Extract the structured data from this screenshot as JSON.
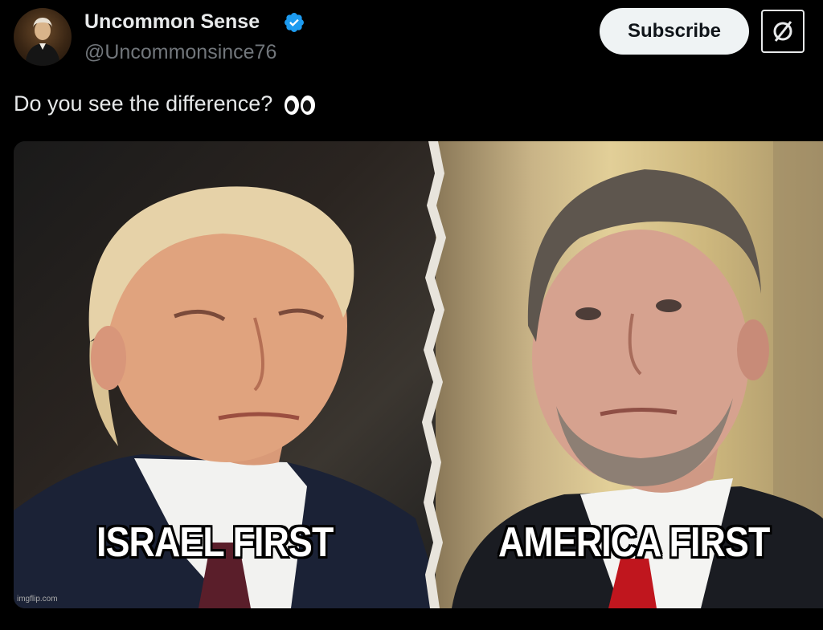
{
  "author": {
    "display_name": "Uncommon Sense",
    "handle": "@Uncommonsince76",
    "verified": true,
    "avatar_icon": "portrait-avatar"
  },
  "actions": {
    "subscribe_label": "Subscribe",
    "grok_icon": "grok-icon"
  },
  "tweet": {
    "text": "Do you see the difference?",
    "emoji_icon": "eyes-emoji-icon"
  },
  "media": {
    "left_caption": "ISRAEL FIRST",
    "right_caption": "AMERICA FIRST",
    "watermark": "imgflip.com"
  },
  "colors": {
    "background": "#000000",
    "text_primary": "#e7e9ea",
    "text_secondary": "#71767b",
    "verified_blue": "#1d9bf0",
    "button_bg": "#eff3f4"
  }
}
